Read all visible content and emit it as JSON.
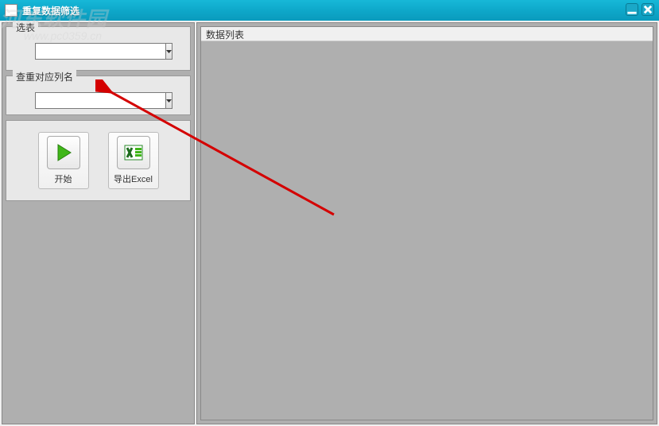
{
  "window": {
    "title": "重复数据筛选"
  },
  "left": {
    "group1": {
      "legend": "选表"
    },
    "group2": {
      "legend": "查重对应列名",
      "value": ""
    },
    "buttons": {
      "start": "开始",
      "export": "导出Excel"
    }
  },
  "right": {
    "header": "数据列表"
  },
  "watermark": {
    "line1": "河东软件园",
    "line2": "www.pc0359.cn"
  }
}
